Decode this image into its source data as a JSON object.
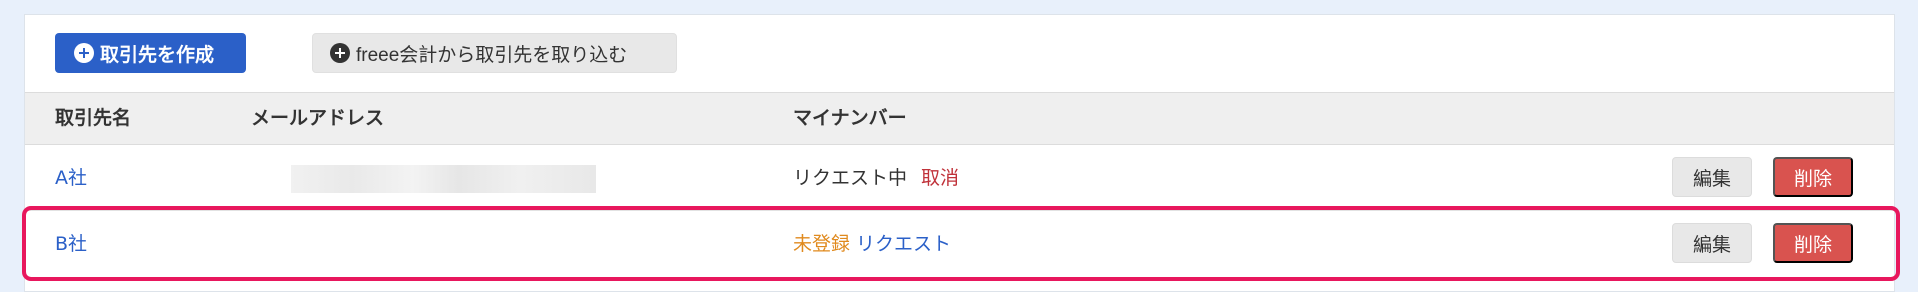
{
  "toolbar": {
    "create_label": "取引先を作成",
    "import_label": "freee会計から取引先を取り込む"
  },
  "table": {
    "headers": {
      "name": "取引先名",
      "email": "メールアドレス",
      "mynumber": "マイナンバー"
    },
    "rows": [
      {
        "name": "A社",
        "email": "",
        "status": "リクエスト中",
        "action_link": "取消",
        "edit_label": "編集",
        "delete_label": "削除"
      },
      {
        "name": "B社",
        "email": "",
        "status": "未登録",
        "action_link": "リクエスト",
        "edit_label": "編集",
        "delete_label": "削除"
      }
    ]
  },
  "colors": {
    "primary": "#2b60c8",
    "danger": "#d9534f",
    "cancel_text": "#c0323a",
    "unregistered_text": "#e08a1e",
    "highlight": "#e8175d"
  }
}
